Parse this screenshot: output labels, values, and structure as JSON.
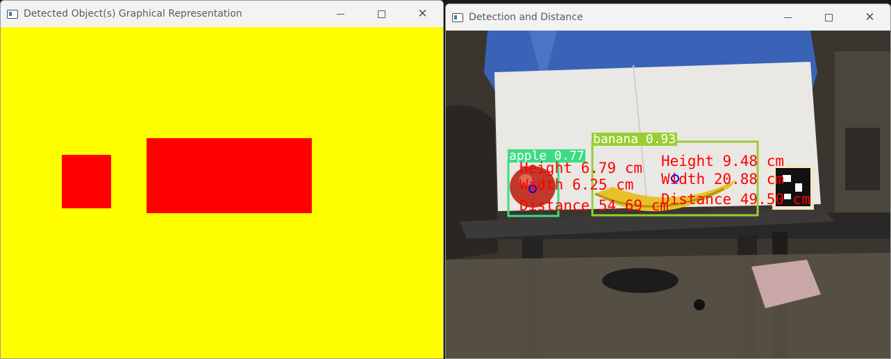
{
  "left_window": {
    "title": "Detected Object(s) Graphical Representation",
    "canvas_color": "#ffff00",
    "shape_color": "#ff0000",
    "close_glyph": "✕"
  },
  "right_window": {
    "title": "Detection and Distance",
    "close_glyph": "✕",
    "detections": [
      {
        "label": "apple 0.77",
        "box_color": "#3ddc84",
        "height": "Height 6.79 cm",
        "width": "Width 6.25 cm",
        "distance": "Distance 54.69 cm"
      },
      {
        "label": "banana 0.93",
        "box_color": "#9acd32",
        "height": "Height 9.48 cm",
        "width": "Width 20.88 cm",
        "distance": "Distance 49.50 cm"
      }
    ],
    "center_marker_color": "#0000ff"
  }
}
